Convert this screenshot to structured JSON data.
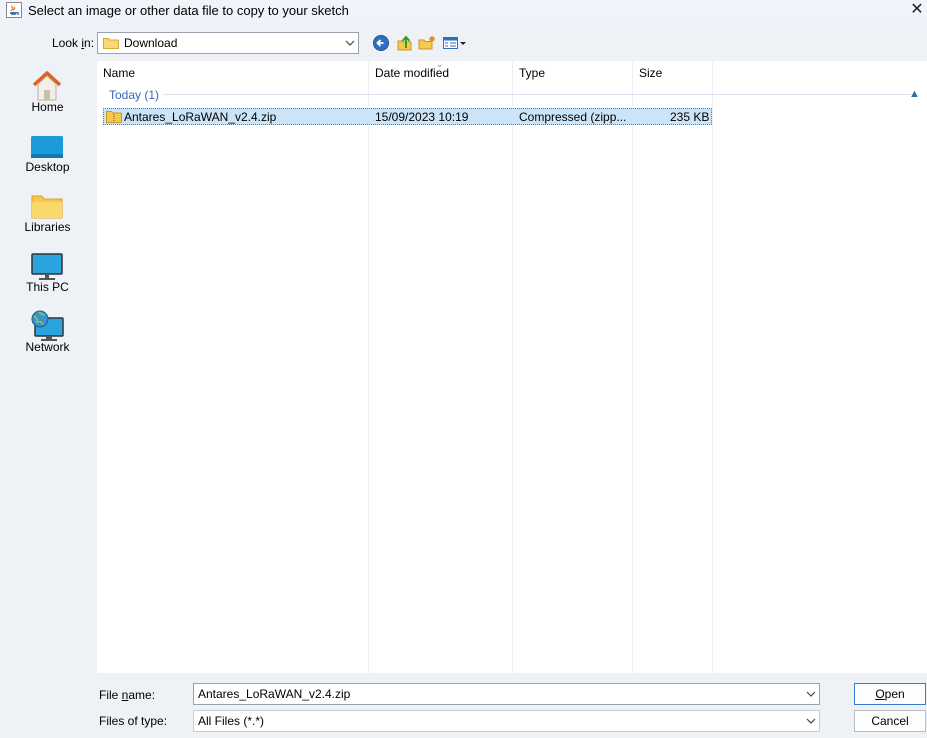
{
  "window": {
    "title": "Select an image or other data file to copy to your sketch",
    "close_glyph": "✕"
  },
  "lookin": {
    "label_prefix": "Look ",
    "label_mnemonic": "i",
    "label_suffix": "n:",
    "value": "Download"
  },
  "toolbar": {
    "icons": [
      "back-icon",
      "up-one-level-icon",
      "create-new-folder-icon",
      "view-menu-icon"
    ]
  },
  "places": [
    {
      "label": "Home",
      "icon": "home-icon"
    },
    {
      "label": "Desktop",
      "icon": "desktop-icon"
    },
    {
      "label": "Libraries",
      "icon": "libraries-icon"
    },
    {
      "label": "This PC",
      "icon": "this-pc-icon"
    },
    {
      "label": "Network",
      "icon": "network-icon"
    }
  ],
  "columns": [
    "Name",
    "Date modified",
    "Type",
    "Size"
  ],
  "group": {
    "label": "Today (1)",
    "collapse_glyph": "▲"
  },
  "files": [
    {
      "name": "Antares_LoRaWAN_v2.4.zip",
      "date": "15/09/2023 10:19",
      "type": "Compressed (zipp...",
      "size": "235 KB",
      "icon": "zip-folder-icon",
      "selected": true
    }
  ],
  "filename": {
    "label_prefix": "File ",
    "label_mnemonic": "n",
    "label_suffix": "ame:",
    "value": "Antares_LoRaWAN_v2.4.zip"
  },
  "filetype": {
    "label": "Files of type:",
    "value": "All Files (*.*)"
  },
  "buttons": {
    "open_mnemonic": "O",
    "open_rest": "pen",
    "cancel": "Cancel"
  },
  "colors": {
    "accent": "#3a7bd5",
    "selection": "#cce4f7",
    "group_header": "#3566b8"
  }
}
